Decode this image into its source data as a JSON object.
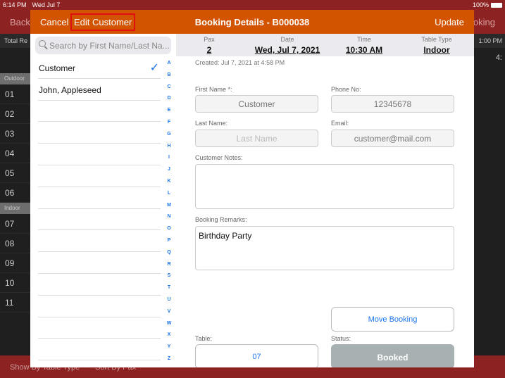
{
  "status_bar": {
    "time": "6:14 PM",
    "date": "Wed Jul 7",
    "battery": "100%"
  },
  "background": {
    "back": "Back",
    "booking": "Booking",
    "total": "Total Re",
    "time_right": "1:00 PM",
    "partial": "4:",
    "sections": [
      {
        "name": "Outdoor",
        "tables": [
          "01",
          "02",
          "03",
          "04",
          "05",
          "06"
        ]
      },
      {
        "name": "Indoor",
        "tables": [
          "07",
          "08",
          "09",
          "10",
          "11"
        ]
      }
    ],
    "bottom": {
      "show_by": "Show By Table Type",
      "sort_by": "Sort By Pax"
    }
  },
  "header": {
    "cancel": "Cancel",
    "edit_customer": "Edit Customer",
    "title": "Booking Details - B000038",
    "update": "Update"
  },
  "search": {
    "placeholder": "Search by First Name/Last Na..."
  },
  "customers": [
    {
      "name": "Customer",
      "selected": true
    },
    {
      "name": "John, Appleseed",
      "selected": false
    }
  ],
  "index": [
    "A",
    "B",
    "C",
    "D",
    "E",
    "F",
    "G",
    "H",
    "I",
    "J",
    "K",
    "L",
    "M",
    "N",
    "O",
    "P",
    "Q",
    "R",
    "S",
    "T",
    "U",
    "V",
    "W",
    "X",
    "Y",
    "Z"
  ],
  "info": {
    "pax_label": "Pax",
    "pax": "2",
    "date_label": "Date",
    "date": "Wed, Jul 7, 2021",
    "time_label": "Time",
    "time": "10:30 AM",
    "type_label": "Table Type",
    "type": "Indoor"
  },
  "form": {
    "created": "Created: Jul 7, 2021 at 4:58 PM",
    "first_name_label": "First Name *:",
    "first_name": "Customer",
    "phone_label": "Phone No:",
    "phone": "12345678",
    "last_name_label": "Last Name:",
    "last_name_placeholder": "Last Name",
    "email_label": "Email:",
    "email": "customer@mail.com",
    "notes_label": "Customer Notes:",
    "notes": "",
    "remarks_label": "Booking Remarks:",
    "remarks": "Birthday Party",
    "move_booking": "Move Booking",
    "table_label": "Table:",
    "table": "07",
    "status_label": "Status:",
    "status": "Booked"
  },
  "colors": {
    "header": "#d35400",
    "accent": "#1a73e8",
    "background_bar": "#8c2222",
    "status_button": "#a7b1b1"
  }
}
